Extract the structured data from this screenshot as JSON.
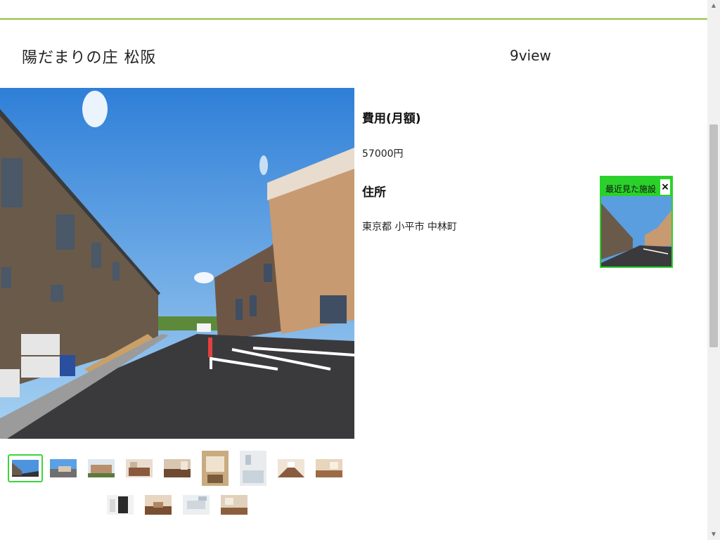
{
  "facility": {
    "name": "陽だまりの庄 松阪",
    "views": "9view"
  },
  "info": {
    "fee_label": "費用(月額)",
    "fee_value": "57000円",
    "address_label": "住所",
    "address_value": "東京都 小平市 中林町"
  },
  "recent": {
    "label": "最近見た施設",
    "close": "×"
  },
  "gallery": {
    "photo_count": 13,
    "active_index": 0
  },
  "colors": {
    "accent_green": "#8cc63f",
    "highlight_green": "#2bd12b"
  }
}
